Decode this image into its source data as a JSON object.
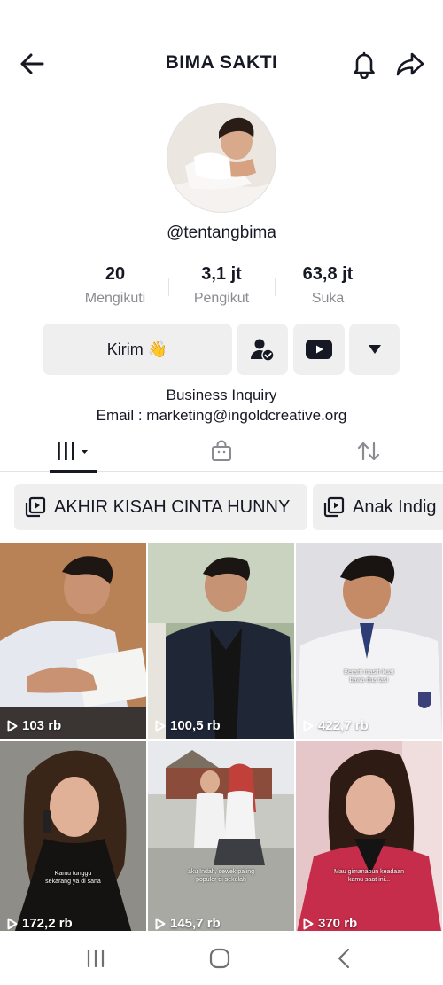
{
  "header": {
    "title": "BIMA SAKTI"
  },
  "profile": {
    "username": "@tentangbima",
    "stats": [
      {
        "value": "20",
        "label": "Mengikuti"
      },
      {
        "value": "3,1 jt",
        "label": "Pengikut"
      },
      {
        "value": "63,8 jt",
        "label": "Suka"
      }
    ],
    "message_button": "Kirim 👋",
    "bio": [
      "Business Inquiry",
      "Email : marketing@ingoldcreative.org"
    ]
  },
  "tabs": [
    {
      "icon": "grid-icon",
      "active": true
    },
    {
      "icon": "shop-bag-icon",
      "active": false
    },
    {
      "icon": "repost-icon",
      "active": false
    }
  ],
  "playlists": [
    "AKHIR KISAH CINTA HUNNY",
    "Anak Indig"
  ],
  "videos": [
    {
      "views": "103 rb",
      "caption": ""
    },
    {
      "views": "100,5 rb",
      "caption": ""
    },
    {
      "views": "422,7 rb",
      "caption": "Berarti masih kuat\nbawa dua tas!"
    },
    {
      "views": "172,2 rb",
      "caption": "Kamu tunggu\nsekarang ya di sana"
    },
    {
      "views": "145,7 rb",
      "caption": "aku Indah, cewek paling\npopuler di sekolah"
    },
    {
      "views": "370 rb",
      "caption": "Mau gimanapun keadaan\nkamu saat ini..."
    }
  ],
  "colors": {
    "text": "#161823",
    "muted": "#8a8b91",
    "button_bg": "#efeff0",
    "divider": "#e3e3e4"
  }
}
